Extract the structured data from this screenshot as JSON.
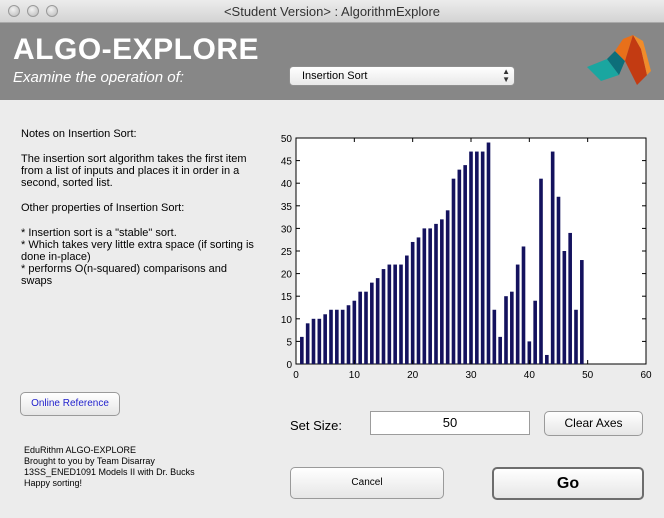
{
  "window": {
    "title": "<Student Version> : AlgorithmExplore"
  },
  "banner": {
    "app_title": "ALGO-EXPLORE",
    "subtitle": "Examine the operation of:",
    "algorithm_select": {
      "selected": "Insertion Sort"
    }
  },
  "notes": {
    "heading": "Notes on Insertion Sort:",
    "description": "The insertion sort algorithm takes the first item from a list of inputs and places it in order in a second, sorted list.",
    "properties_heading": "Other properties of Insertion Sort:",
    "bullets": [
      " * Insertion sort is a \"stable\" sort.",
      " * Which takes very little extra space (if sorting is done in-place)",
      " * performs O(n-squared) comparisons and swaps"
    ]
  },
  "online_reference_label": "Online Reference",
  "credits": {
    "line1": "EduRithm ALGO-EXPLORE",
    "line2": "Brought to you by Team Disarray",
    "line3": "13SS_ENED1091 Models II with Dr. Bucks",
    "line4": "Happy sorting!"
  },
  "controls": {
    "set_size_label": "Set Size:",
    "set_size_value": "50",
    "clear_axes_label": "Clear Axes",
    "cancel_label": "Cancel",
    "go_label": "Go"
  },
  "colors": {
    "bar": "#14125e",
    "banner": "#878787"
  },
  "chart_data": {
    "type": "bar",
    "xlim": [
      0,
      60
    ],
    "ylim": [
      0,
      50
    ],
    "xticks": [
      0,
      10,
      20,
      30,
      40,
      50,
      60
    ],
    "yticks": [
      0,
      5,
      10,
      15,
      20,
      25,
      30,
      35,
      40,
      45,
      50
    ],
    "x": [
      1,
      2,
      3,
      4,
      5,
      6,
      7,
      8,
      9,
      10,
      11,
      12,
      13,
      14,
      15,
      16,
      17,
      18,
      19,
      20,
      21,
      22,
      23,
      24,
      25,
      26,
      27,
      28,
      29,
      30,
      31,
      32,
      33,
      34,
      35,
      36,
      37,
      38,
      39,
      40,
      41,
      42,
      43,
      44,
      45,
      46,
      47,
      48,
      49,
      50
    ],
    "values": [
      6,
      9,
      10,
      10,
      11,
      12,
      12,
      12,
      13,
      14,
      16,
      16,
      18,
      19,
      21,
      22,
      22,
      22,
      24,
      27,
      28,
      30,
      30,
      31,
      32,
      34,
      41,
      43,
      44,
      47,
      47,
      47,
      49,
      12,
      6,
      15,
      16,
      22,
      26,
      5,
      14,
      41,
      2,
      47,
      37,
      25,
      29,
      12,
      23,
      0
    ]
  }
}
